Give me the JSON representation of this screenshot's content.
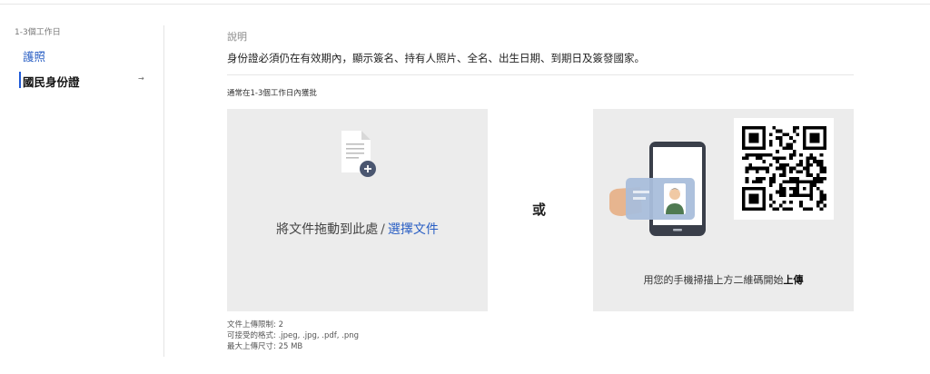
{
  "sidebar": {
    "group_label": "1-3個工作日",
    "items": [
      {
        "label": "護照",
        "active": false
      },
      {
        "label": "國民身份證",
        "active": true,
        "arrow": "→"
      }
    ]
  },
  "main": {
    "description_label": "說明",
    "description_text": "身份證必須仍在有效期內，顯示簽名、持有人照片、全名、出生日期、到期日及簽發國家。",
    "approval_note": "通常在1-3個工作日內獲批",
    "dropzone": {
      "text": "將文件拖動到此處",
      "separator": "/",
      "choose_label": "選擇文件",
      "icon": "document-add-icon"
    },
    "or_label": "或",
    "qr": {
      "text_prefix": "用您的手機掃描上方二維碼開始",
      "text_bold": "上傳",
      "icon": "qr-code"
    },
    "limits": {
      "count": "文件上傳限制: 2",
      "formats": "可接受的格式: .jpeg, .jpg, .pdf, .png",
      "max_size": "最大上傳尺寸: 25 MB"
    }
  },
  "colors": {
    "accent": "#2a5fc4",
    "active_bar": "#1f5ad8",
    "panel_bg": "#ececec"
  }
}
